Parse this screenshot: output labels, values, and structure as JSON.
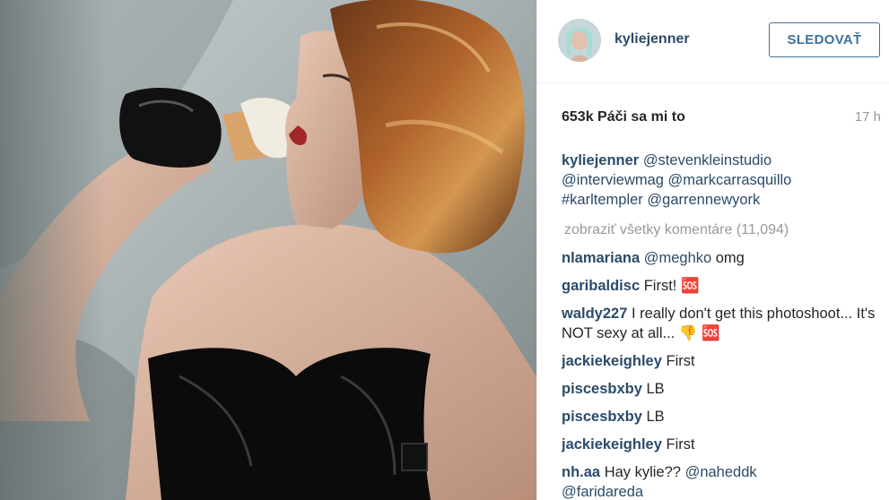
{
  "post": {
    "author": "kyliejenner",
    "follow_label": "SLEDOVAŤ",
    "likes": "653k Páči sa mi to",
    "time": "17 h",
    "caption": {
      "user": "kyliejenner",
      "mentions": [
        "@stevenkleinstudio",
        "@interviewmag",
        "@markcarrasquillo",
        "#karltempler",
        "@garrennewyork"
      ]
    },
    "view_all": "zobraziť všetky komentáre (11,094)"
  },
  "comments": [
    {
      "user": "nlamariana",
      "mention": "@meghko",
      "text": " omg"
    },
    {
      "user": "garibaldisc",
      "text": " First! 🆘"
    },
    {
      "user": "waldy227",
      "text": " I really don't get this photoshoot... It's NOT sexy at all... 👎 🆘"
    },
    {
      "user": "jackiekeighley",
      "text": " First"
    },
    {
      "user": "piscesbxby",
      "text": " LB"
    },
    {
      "user": "piscesbxby",
      "text": " LB"
    },
    {
      "user": "jackiekeighley",
      "text": " First"
    },
    {
      "user": "nh.aa",
      "text": " Hay kylie?? ",
      "mention": "@naheddk",
      "mention2": "@faridareda"
    }
  ],
  "icons": {
    "avatar": "profile-photo",
    "post_image": "fashion-photo"
  }
}
